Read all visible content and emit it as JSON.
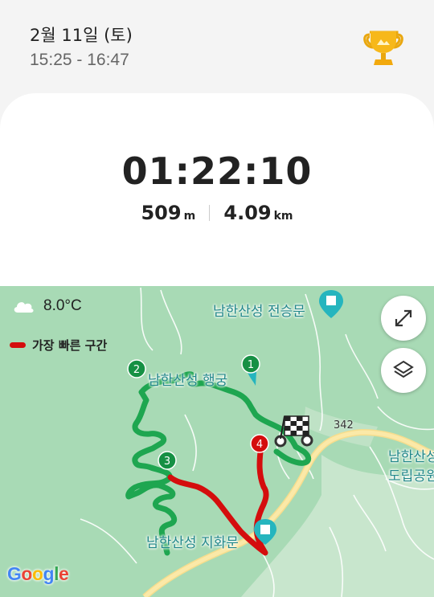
{
  "header": {
    "date": "2월 11일 (토)",
    "time_range": "15:25 - 16:47",
    "trophy_icon": "trophy-icon"
  },
  "summary": {
    "duration": "01:22:10",
    "elevation_value": "509",
    "elevation_unit": "m",
    "distance_value": "4.09",
    "distance_unit": "km"
  },
  "map": {
    "weather_icon": "cloud-icon",
    "temperature": "8.0°C",
    "legend_label": "가장 빠른 구간",
    "legend_color": "#d40d0d",
    "route_color": "#1ea650",
    "labels": {
      "jeonseungmun": "남한산성 전승문",
      "haenggung": "남한산성 행궁",
      "jihwamun": "남한산성 지화문",
      "provincial_park_line1": "남한산성",
      "provincial_park_line2": "도립공원"
    },
    "road_number": "342",
    "markers": [
      "1",
      "2",
      "3",
      "4"
    ],
    "attribution": "Google"
  }
}
